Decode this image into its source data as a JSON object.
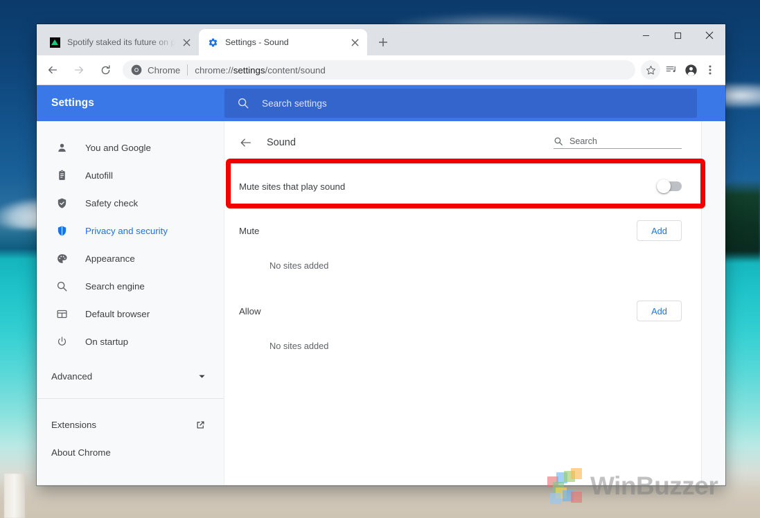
{
  "window": {
    "controls": {
      "minimize": "minimize-button",
      "maximize": "maximize-button",
      "close": "close-button"
    }
  },
  "tabs": [
    {
      "title": "Spotify staked its future on podca",
      "favicon": "spotify-icon",
      "active": false
    },
    {
      "title": "Settings - Sound",
      "favicon": "gear-icon",
      "active": true
    }
  ],
  "new_tab_label": "+",
  "toolbar": {
    "back": "back-arrow-icon",
    "forward": "forward-arrow-icon",
    "reload": "reload-icon",
    "omnibox": {
      "badge_label": "Chrome",
      "url_prefix": "chrome://",
      "url_strong": "settings",
      "url_suffix": "/content/sound"
    },
    "star": "bookmark-star-icon",
    "media": "media-playlist-icon",
    "profile": "profile-avatar-icon",
    "menu": "three-dot-menu-icon"
  },
  "settings": {
    "brand": "Settings",
    "search": {
      "placeholder": "Search settings",
      "value": ""
    },
    "sidebar": {
      "items": [
        {
          "label": "You and Google",
          "icon": "person-icon",
          "selected": false
        },
        {
          "label": "Autofill",
          "icon": "clipboard-icon",
          "selected": false
        },
        {
          "label": "Safety check",
          "icon": "shield-check-icon",
          "selected": false
        },
        {
          "label": "Privacy and security",
          "icon": "shield-icon",
          "selected": true
        },
        {
          "label": "Appearance",
          "icon": "palette-icon",
          "selected": false
        },
        {
          "label": "Search engine",
          "icon": "magnifier-icon",
          "selected": false
        },
        {
          "label": "Default browser",
          "icon": "browser-window-icon",
          "selected": false
        },
        {
          "label": "On startup",
          "icon": "power-icon",
          "selected": false
        }
      ],
      "advanced": {
        "label": "Advanced",
        "icon": "chevron-down-icon"
      },
      "links": [
        {
          "label": "Extensions",
          "icon": "external-link-icon"
        },
        {
          "label": "About Chrome",
          "icon": ""
        }
      ]
    },
    "page": {
      "title": "Sound",
      "back_icon": "back-arrow-icon",
      "search": {
        "placeholder": "Search",
        "value": ""
      },
      "mute_toggle": {
        "label": "Mute sites that play sound",
        "state": "off"
      },
      "sections": [
        {
          "title": "Mute",
          "add_label": "Add",
          "empty_text": "No sites added"
        },
        {
          "title": "Allow",
          "add_label": "Add",
          "empty_text": "No sites added"
        }
      ]
    }
  },
  "highlight": {
    "color": "#f20000",
    "target": "mute-sites-that-play-sound-row"
  },
  "watermark": {
    "text": "WinBuzzer"
  },
  "colors": {
    "settings_header_blue": "#3b78e7",
    "settings_search_blue": "#3465cd",
    "accent_blue": "#1a73e8",
    "highlight_red": "#f20000",
    "chrome_frame": "#dee1e6"
  }
}
